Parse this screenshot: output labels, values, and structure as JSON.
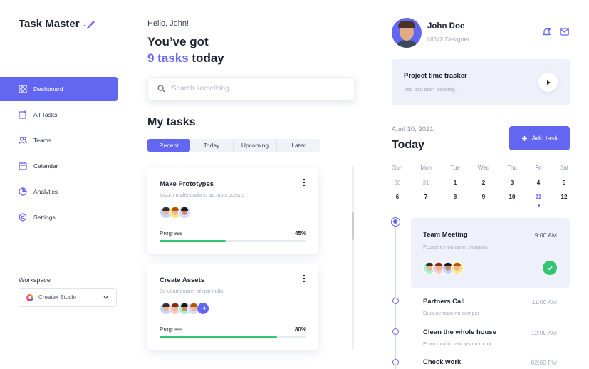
{
  "brand": {
    "name": "Task Master"
  },
  "sidebar": {
    "items": [
      {
        "label": "Dashboard",
        "icon": "grid-icon",
        "active": true
      },
      {
        "label": "All Tasks",
        "icon": "tasks-icon"
      },
      {
        "label": "Teams",
        "icon": "users-icon"
      },
      {
        "label": "Calendar",
        "icon": "calendar-icon"
      },
      {
        "label": "Analytics",
        "icon": "pie-chart-icon"
      },
      {
        "label": "Settings",
        "icon": "settings-icon"
      }
    ],
    "workspace_label": "Workspace",
    "workspace_value": "Createx Studio"
  },
  "main": {
    "greeting": "Hello, John!",
    "headline_line1": "You’ve got",
    "headline_count": "9 tasks",
    "headline_suffix": " today",
    "search_placeholder": "Search something...",
    "section_title": "My tasks",
    "tabs": [
      {
        "label": "Recent",
        "active": true
      },
      {
        "label": "Today"
      },
      {
        "label": "Upcoming"
      },
      {
        "label": "Later"
      }
    ],
    "tasks": [
      {
        "title": "Make Prototypes",
        "description": "Ipsum malesuada id ac, quis cursus",
        "progress_label": "Progress",
        "progress_text": "45%",
        "progress": 0.45
      },
      {
        "title": "Create Assets",
        "description": "Sit ullamcorper id nisi nulla",
        "progress_label": "Progress",
        "progress_text": "80%",
        "progress": 0.8,
        "extra_members": "+4"
      }
    ]
  },
  "profile": {
    "name": "John Doe",
    "role": "UI/UX Designer"
  },
  "tracker": {
    "title": "Project time tracker",
    "subtitle": "You can start tracking."
  },
  "schedule": {
    "date": "April 10, 2021",
    "heading": "Today",
    "add_task_label": "Add task",
    "calendar": [
      {
        "day": "Sun",
        "row1": "30",
        "row2": "6",
        "row1_muted": true
      },
      {
        "day": "Mon",
        "row1": "31",
        "row2": "7",
        "row1_muted": true
      },
      {
        "day": "Tue",
        "row1": "1",
        "row2": "8"
      },
      {
        "day": "Wed",
        "row1": "2",
        "row2": "9"
      },
      {
        "day": "Thu",
        "row1": "3",
        "row2": "10"
      },
      {
        "day": "Fri",
        "row1": "4",
        "row2": "11",
        "selected": true
      },
      {
        "day": "Sat",
        "row1": "5",
        "row2": "12"
      }
    ],
    "meeting": {
      "title": "Team Meeting",
      "time": "9:00 AM",
      "description": "Posuere non amet vivamus"
    },
    "events": [
      {
        "title": "Partners Call",
        "time": "11:00 AM",
        "description": "Duis aenean mi semper"
      },
      {
        "title": "Clean the whole house",
        "time": "12:00 AM",
        "description": "Enim morbi nam ipsum tortor"
      },
      {
        "title": "Check work",
        "time": "02:00 PM",
        "description": ""
      }
    ]
  },
  "colors": {
    "accent": "#6366f1",
    "success": "#34c472",
    "panel": "#eff1fa"
  }
}
